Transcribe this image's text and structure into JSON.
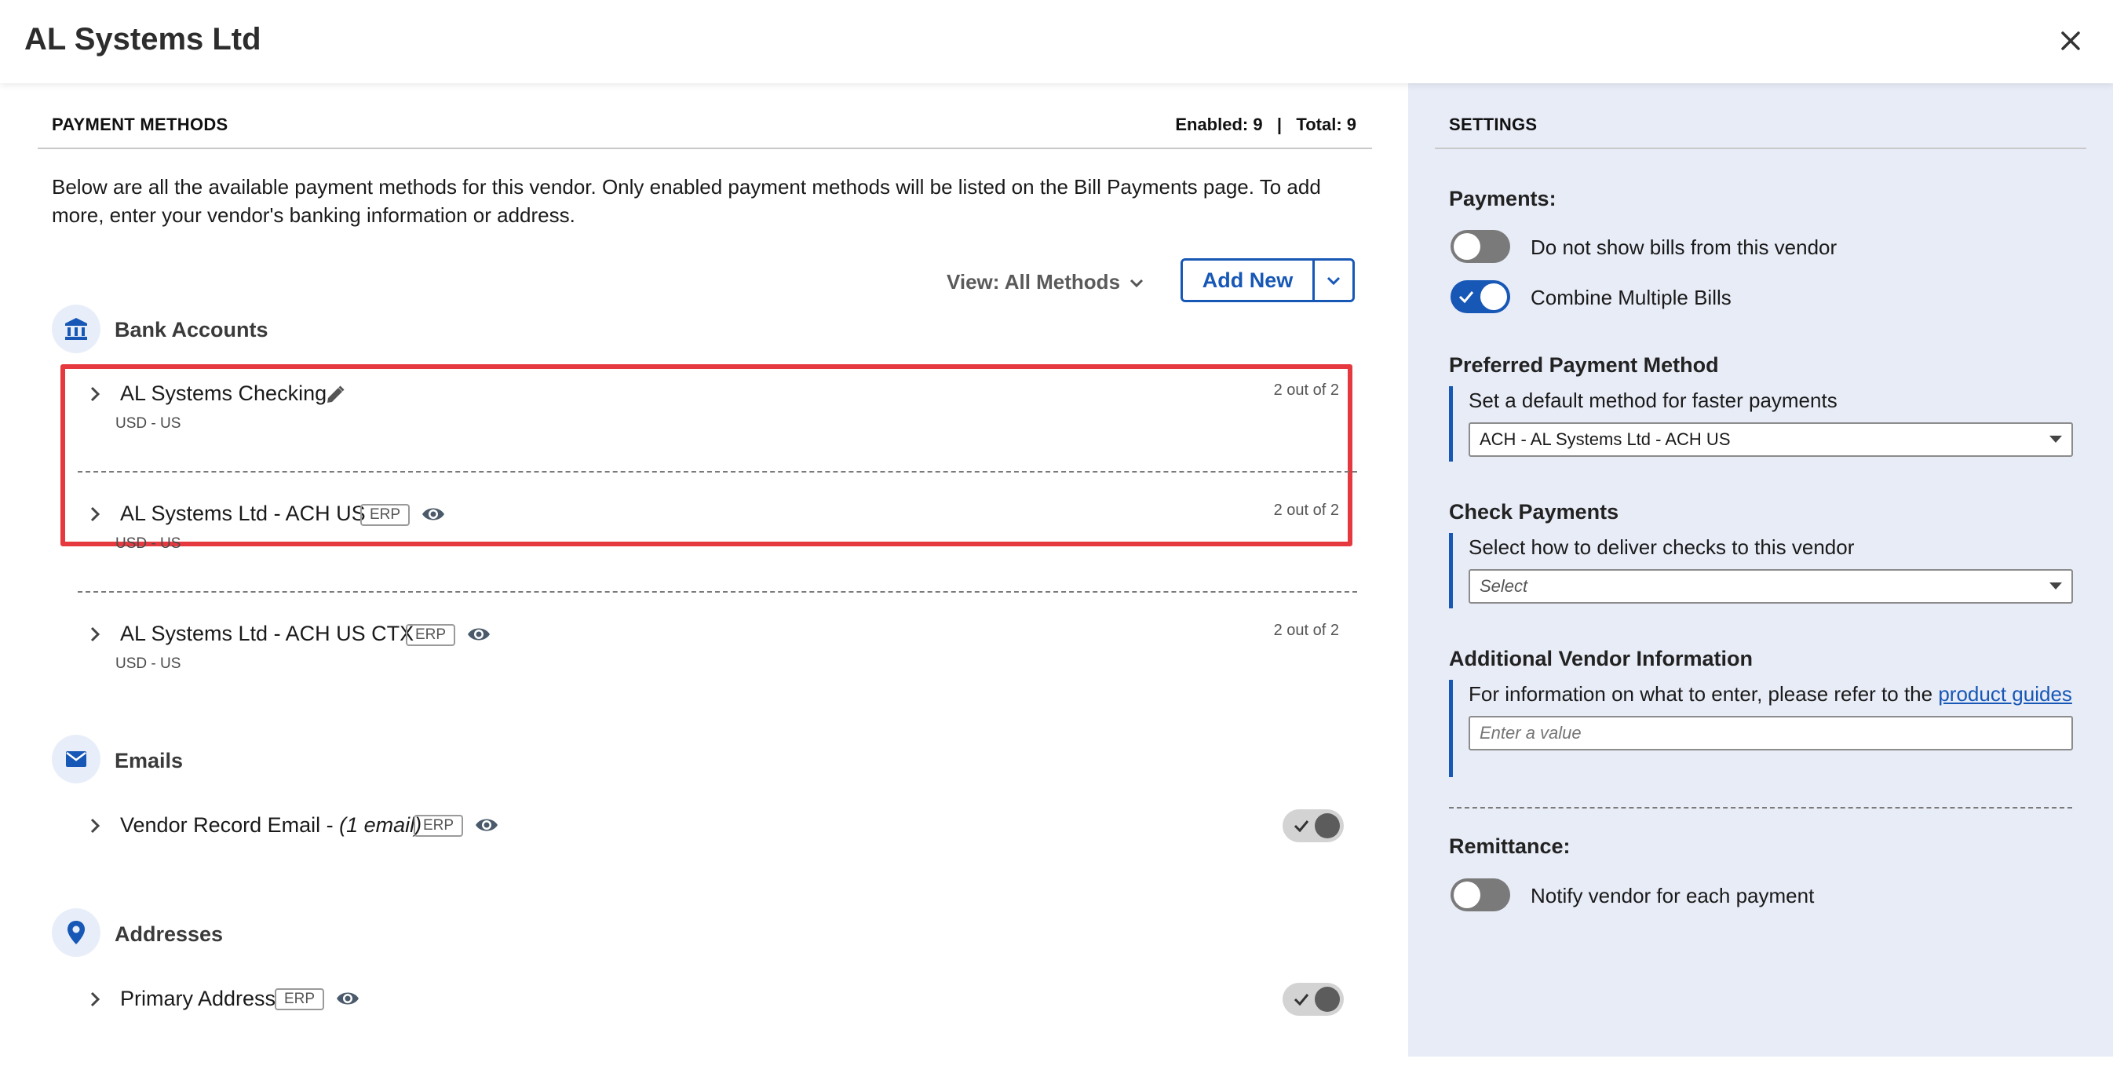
{
  "header": {
    "title": "AL Systems Ltd",
    "close_icon": "close-icon"
  },
  "payment_methods": {
    "heading": "PAYMENT METHODS",
    "counts": "Enabled: 9   |   Total: 9",
    "description": "Below are all the available payment methods for this vendor. Only enabled payment methods will be listed on the Bill Payments page. To add more, enter your vendor's banking information or address.",
    "view_label": "View: All Methods",
    "add_new_label": "Add New",
    "bank_accounts": {
      "label": "Bank Accounts",
      "icon": "bank-icon",
      "items": [
        {
          "name": "AL Systems Checking",
          "sub": "USD - US",
          "count": "2 out of 2",
          "highlighted": true
        },
        {
          "name": "AL Systems Ltd - ACH US",
          "sub": "USD - US",
          "count": "2 out of 2",
          "erp": "ERP"
        },
        {
          "name": "AL Systems Ltd - ACH US CTX",
          "sub": "USD - US",
          "count": "2 out of 2",
          "erp": "ERP"
        }
      ]
    },
    "emails": {
      "label": "Emails",
      "icon": "mail-icon",
      "items": [
        {
          "name": "Vendor Record Email - ",
          "name_italic": "(1 email)",
          "erp": "ERP",
          "enabled": true
        }
      ]
    },
    "addresses": {
      "label": "Addresses",
      "icon": "location-pin-icon",
      "items": [
        {
          "name": "Primary Address",
          "erp": "ERP",
          "enabled": true
        }
      ]
    }
  },
  "settings": {
    "heading": "SETTINGS",
    "payments": {
      "label": "Payments:",
      "toggles": [
        {
          "label": "Do not show bills from this vendor",
          "on": false
        },
        {
          "label": "Combine Multiple Bills",
          "on": true
        }
      ]
    },
    "preferred": {
      "label": "Preferred Payment Method",
      "help": "Set a default method for faster payments",
      "value": "ACH - AL Systems Ltd - ACH US"
    },
    "check": {
      "label": "Check Payments",
      "help": "Select how to deliver checks to this vendor",
      "placeholder": "Select"
    },
    "additional": {
      "label": "Additional Vendor Information",
      "help": "For information on what to enter, please refer to the ",
      "link": "product guides",
      "placeholder": "Enter a value"
    },
    "remittance": {
      "label": "Remittance:",
      "toggle_label": "Notify vendor for each payment",
      "on": false
    }
  },
  "colors": {
    "accent": "#1757b6",
    "highlight": "#e6393f",
    "settings_bg": "#e8ecf7"
  }
}
